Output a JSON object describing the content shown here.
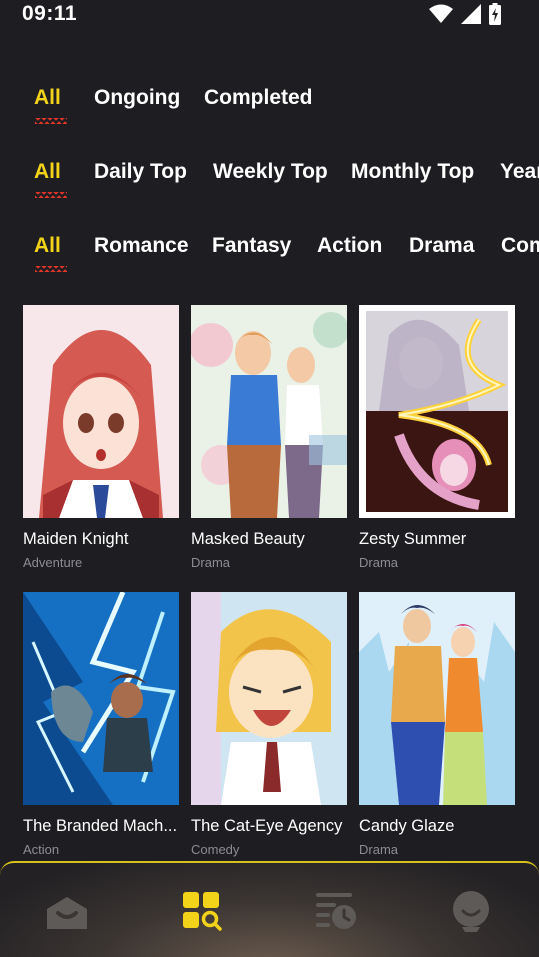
{
  "status_bar": {
    "time": "09:11",
    "icons": [
      "wifi-icon",
      "signal-icon",
      "battery-icon"
    ]
  },
  "filters": {
    "status": [
      {
        "label": "All",
        "active": true
      },
      {
        "label": "Ongoing",
        "active": false
      },
      {
        "label": "Completed",
        "active": false
      }
    ],
    "ranking": [
      {
        "label": "All",
        "active": true
      },
      {
        "label": "Daily Top",
        "active": false
      },
      {
        "label": "Weekly Top",
        "active": false
      },
      {
        "label": "Monthly Top",
        "active": false
      },
      {
        "label": "Year",
        "active": false
      }
    ],
    "genre": [
      {
        "label": "All",
        "active": true
      },
      {
        "label": "Romance",
        "active": false
      },
      {
        "label": "Fantasy",
        "active": false
      },
      {
        "label": "Action",
        "active": false
      },
      {
        "label": "Drama",
        "active": false
      },
      {
        "label": "Com",
        "active": false
      }
    ]
  },
  "comics": [
    {
      "title": "Maiden Knight",
      "genre": "Adventure"
    },
    {
      "title": "Masked Beauty",
      "genre": "Drama"
    },
    {
      "title": "Zesty Summer",
      "genre": "Drama"
    },
    {
      "title": "The Branded Mach...",
      "genre": "Action"
    },
    {
      "title": "The Cat-Eye Agency",
      "genre": "Comedy"
    },
    {
      "title": "Candy Glaze",
      "genre": "Drama"
    }
  ],
  "bottom_nav": {
    "items": [
      {
        "icon": "home-icon",
        "active": false
      },
      {
        "icon": "browse-icon",
        "active": true
      },
      {
        "icon": "history-icon",
        "active": false
      },
      {
        "icon": "profile-icon",
        "active": false
      }
    ]
  },
  "colors": {
    "background": "#1e1d21",
    "accent": "#f2d31a",
    "underline": "#e0362a",
    "secondary_text": "#8e8c93"
  }
}
